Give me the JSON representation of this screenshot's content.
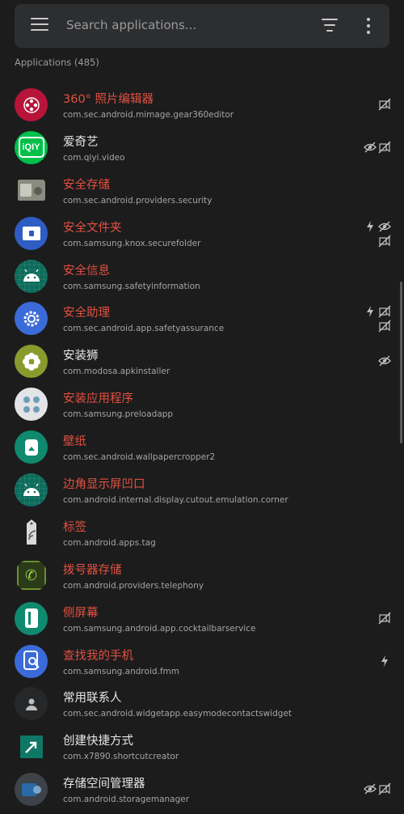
{
  "search": {
    "placeholder": "Search applications..."
  },
  "section": {
    "count_label": "Applications (485)"
  },
  "colors": {
    "background": "#1c1c1d",
    "bar": "#2d2e30",
    "system_app_name": "#e2503f",
    "user_app_name": "#e8e8e8"
  },
  "apps": [
    {
      "name": "360° 照片编辑器",
      "package": "com.sec.android.mimage.gear360editor",
      "system": true,
      "icon": "gear360-icon",
      "flags": [
        "no-internet-icon"
      ]
    },
    {
      "name": "爱奇艺",
      "package": "com.qiyi.video",
      "system": false,
      "icon": "iqiyi-icon",
      "flags": [
        "hidden-icon",
        "no-internet-icon"
      ]
    },
    {
      "name": "安全存储",
      "package": "com.sec.android.providers.security",
      "system": true,
      "icon": "security-storage-icon",
      "flags": []
    },
    {
      "name": "安全文件夹",
      "package": "com.samsung.knox.securefolder",
      "system": true,
      "icon": "secure-folder-icon",
      "flags": [
        "bolt-icon",
        "hidden-icon",
        "no-internet-icon"
      ]
    },
    {
      "name": "安全信息",
      "package": "com.samsung.safetyinformation",
      "system": true,
      "icon": "android-icon",
      "flags": []
    },
    {
      "name": "安全助理",
      "package": "com.sec.android.app.safetyassurance",
      "system": true,
      "icon": "settings-gear-icon",
      "flags": [
        "bolt-icon",
        "no-internet-icon",
        "no-internet-icon"
      ]
    },
    {
      "name": "安装狮",
      "package": "com.modosa.apkinstaller",
      "system": false,
      "icon": "flower-icon",
      "flags": [
        "hidden-icon"
      ]
    },
    {
      "name": "安装应用程序",
      "package": "com.samsung.preloadapp",
      "system": true,
      "icon": "preload-install-icon",
      "flags": []
    },
    {
      "name": "壁纸",
      "package": "com.sec.android.wallpapercropper2",
      "system": true,
      "icon": "wallpaper-icon",
      "flags": []
    },
    {
      "name": "边角显示屏凹口",
      "package": "com.android.internal.display.cutout.emulation.corner",
      "system": true,
      "icon": "android-icon",
      "flags": []
    },
    {
      "name": "标签",
      "package": "com.android.apps.tag",
      "system": true,
      "icon": "nfc-tag-icon",
      "flags": []
    },
    {
      "name": "拨号器存储",
      "package": "com.android.providers.telephony",
      "system": true,
      "icon": "phone-icon",
      "flags": []
    },
    {
      "name": "侧屏幕",
      "package": "com.samsung.android.app.cocktailbarservice",
      "system": true,
      "icon": "edge-screen-icon",
      "flags": [
        "no-internet-icon"
      ]
    },
    {
      "name": "查找我的手机",
      "package": "com.samsung.android.fmm",
      "system": true,
      "icon": "find-phone-icon",
      "flags": [
        "bolt-icon"
      ]
    },
    {
      "name": "常用联系人",
      "package": "com.sec.android.widgetapp.easymodecontactswidget",
      "system": false,
      "icon": "contact-icon",
      "flags": []
    },
    {
      "name": "创建快捷方式",
      "package": "com.x7890.shortcutcreator",
      "system": false,
      "icon": "shortcut-arrow-icon",
      "flags": []
    },
    {
      "name": "存储空间管理器",
      "package": "com.android.storagemanager",
      "system": false,
      "icon": "storage-manager-icon",
      "flags": [
        "hidden-icon",
        "no-internet-icon"
      ]
    }
  ]
}
